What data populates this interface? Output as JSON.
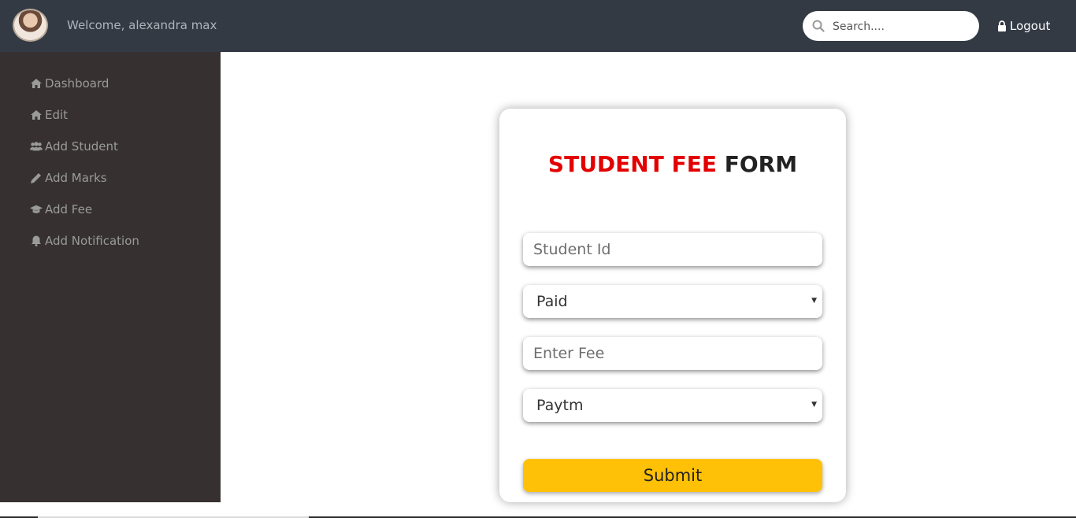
{
  "header": {
    "welcome_text": "Welcome, alexandra max",
    "search_placeholder": "Search....",
    "logout_label": "Logout",
    "background_color": "#343a44"
  },
  "sidebar": {
    "background_color": "#363030",
    "items": [
      {
        "label": "Dashboard",
        "icon": "home-icon"
      },
      {
        "label": "Edit",
        "icon": "home-icon"
      },
      {
        "label": "Add Student",
        "icon": "users-icon"
      },
      {
        "label": "Add Marks",
        "icon": "pencil-icon"
      },
      {
        "label": "Add Fee",
        "icon": "graduation-cap-icon"
      },
      {
        "label": "Add Notification",
        "icon": "bell-icon"
      }
    ]
  },
  "form": {
    "title_accent": "STUDENT FEE",
    "title_rest": " FORM",
    "accent_color": "#e30000",
    "student_id_placeholder": "Student Id",
    "status_value": "Paid",
    "fee_placeholder": "Enter Fee",
    "payment_mode_value": "Paytm",
    "submit_label": "Submit",
    "submit_color": "#ffc107"
  }
}
